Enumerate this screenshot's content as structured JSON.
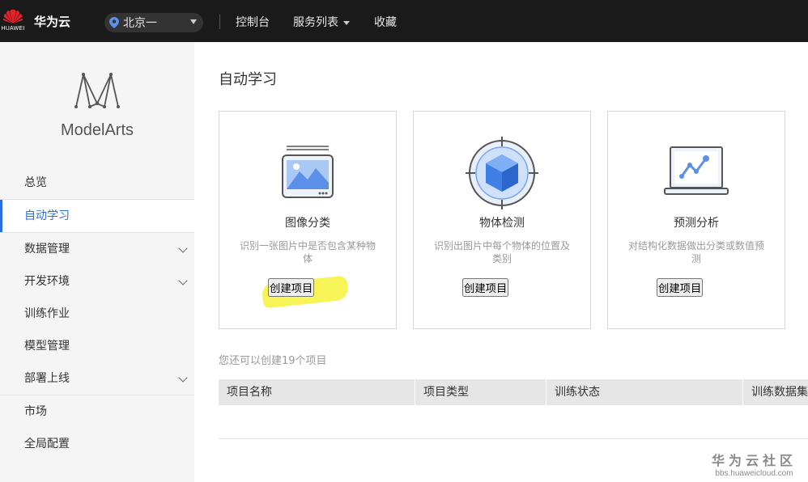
{
  "topbar": {
    "brand_word": "HUAWEI",
    "brand_name": "华为云",
    "region": "北京一",
    "nav": [
      "控制台",
      "服务列表",
      "收藏"
    ]
  },
  "sidebar": {
    "product": "ModelArts",
    "items": [
      {
        "label": "总览"
      },
      {
        "label": "自动学习"
      },
      {
        "label": "数据管理"
      },
      {
        "label": "开发环境"
      },
      {
        "label": "训练作业"
      },
      {
        "label": "模型管理"
      },
      {
        "label": "部署上线"
      },
      {
        "label": "市场"
      },
      {
        "label": "全局配置"
      }
    ]
  },
  "main": {
    "title": "自动学习",
    "cards": [
      {
        "title": "图像分类",
        "desc": "识别一张图片中是否包含某种物体",
        "button": "创建项目",
        "icon": "image-classification-icon"
      },
      {
        "title": "物体检测",
        "desc": "识别出图片中每个物体的位置及类别",
        "button": "创建项目",
        "icon": "object-detection-icon"
      },
      {
        "title": "预测分析",
        "desc": "对结构化数据做出分类或数值预测",
        "button": "创建项目",
        "icon": "predictive-analysis-icon"
      }
    ],
    "remaining": "您还可以创建19个项目",
    "table_headers": [
      "项目名称",
      "项目类型",
      "训练状态",
      "训练数据集"
    ]
  },
  "watermark": {
    "title": "华为云社区",
    "url": "bbs.huaweicloud.com"
  },
  "colors": {
    "topbar_bg": "#1a1a1a",
    "accent": "#2970e0",
    "highlight": "#f6f23a"
  }
}
